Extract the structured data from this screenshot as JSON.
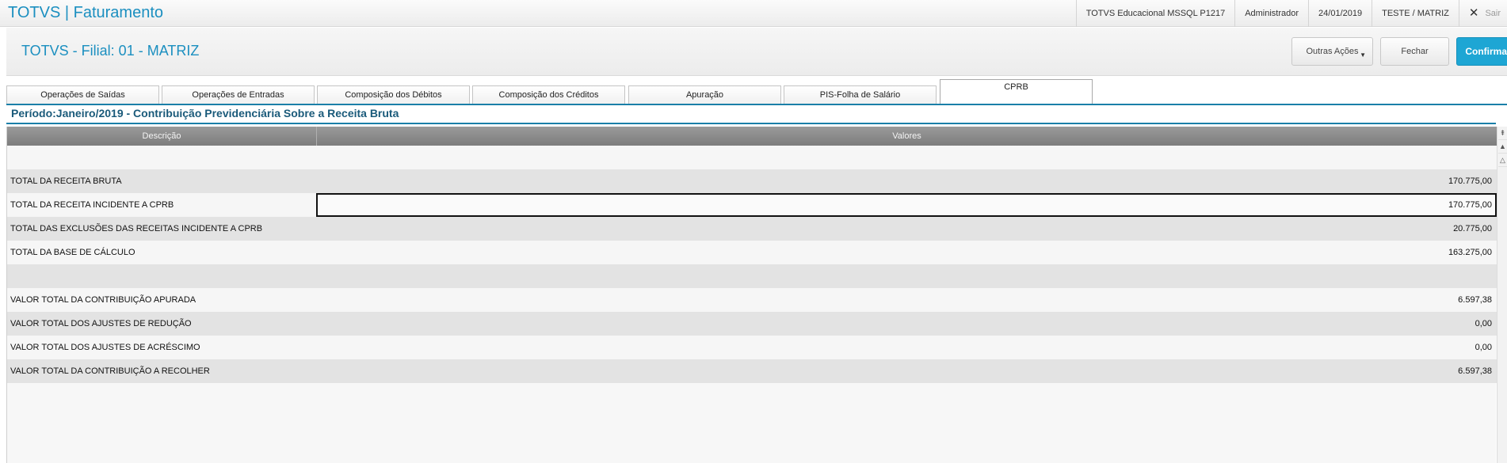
{
  "topbar": {
    "app_title": "TOTVS | Faturamento",
    "environment": "TOTVS Educacional MSSQL P1217",
    "user": "Administrador",
    "date": "24/01/2019",
    "company": "TESTE / MATRIZ",
    "exit_label": "Sair"
  },
  "header": {
    "branch_title": "TOTVS - Filial: 01 - MATRIZ",
    "more_actions_label": "Outras Ações",
    "close_label": "Fechar",
    "confirm_label": "Confirmar",
    "confirm_color": "#1ea6d4"
  },
  "tabs": [
    {
      "label": "Operações de Saídas"
    },
    {
      "label": "Operações de Entradas"
    },
    {
      "label": "Composição dos Débitos"
    },
    {
      "label": "Composição dos Créditos"
    },
    {
      "label": "Apuração"
    },
    {
      "label": "PIS-Folha de Salário"
    },
    {
      "label": "CPRB",
      "active": true
    }
  ],
  "period_title": "Período:Janeiro/2019 - Contribuição Previdenciária Sobre a Receita Bruta",
  "grid": {
    "columns": [
      "Descrição",
      "Valores"
    ],
    "rows": [
      {
        "description": "",
        "value": ""
      },
      {
        "description": "TOTAL DA RECEITA BRUTA",
        "value": "170.775,00"
      },
      {
        "description": "TOTAL DA RECEITA INCIDENTE A CPRB",
        "value": "170.775,00",
        "selected": true
      },
      {
        "description": "TOTAL DAS EXCLUSÕES DAS RECEITAS INCIDENTE A CPRB",
        "value": "20.775,00"
      },
      {
        "description": "TOTAL DA BASE DE CÁLCULO",
        "value": "163.275,00"
      },
      {
        "description": "",
        "value": ""
      },
      {
        "description": "VALOR TOTAL DA CONTRIBUIÇÃO APURADA",
        "value": "6.597,38"
      },
      {
        "description": "VALOR TOTAL DOS AJUSTES DE REDUÇÃO",
        "value": "0,00"
      },
      {
        "description": "VALOR TOTAL DOS AJUSTES DE ACRÉSCIMO",
        "value": "0,00"
      },
      {
        "description": "VALOR TOTAL DA CONTRIBUIÇÃO A RECOLHER",
        "value": "6.597,38"
      }
    ]
  },
  "colors": {
    "accent": "#1b8fc0",
    "tab_line": "#1a7fa8",
    "grid_header": "#8a8a8a",
    "row_alt": "#e3e3e3"
  },
  "icons": {
    "exit": "close-icon",
    "more_actions": "chevron-down-icon",
    "scroll_up": "arrow-up-icon"
  }
}
